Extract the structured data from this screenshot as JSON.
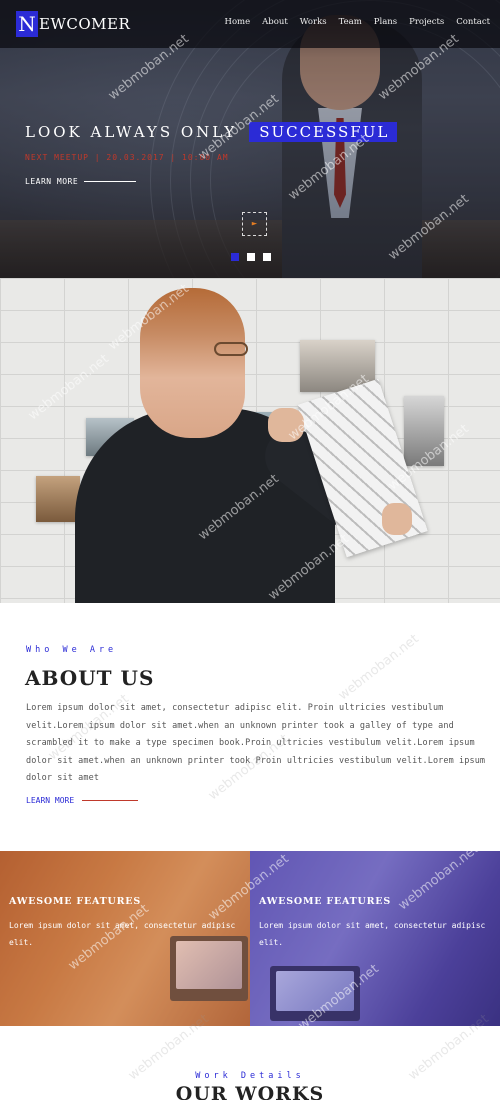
{
  "brand": {
    "initial": "N",
    "rest": "EWCOMER"
  },
  "nav": {
    "items": [
      "Home",
      "About",
      "Works",
      "Team",
      "Plans",
      "Projects",
      "Contact"
    ]
  },
  "hero": {
    "title": "LOOK ALWAYS ONLY",
    "highlight": "SUCCESSFUL",
    "meta": "NEXT MEETUP | 20.03.2017 | 10:00 AM",
    "learn_more": "LEARN MORE",
    "play_icon": "play-icon",
    "slides": 3,
    "active_slide": 1
  },
  "about": {
    "subtitle": "Who We Are",
    "title": "ABOUT US",
    "text": "Lorem ipsum dolor sit amet, consectetur adipisc elit. Proin ultricies vestibulum velit.Lorem ipsum dolor sit amet.when an unknown printer took a galley of type and scrambled it to make a type specimen book.Proin ultricies vestibulum velit.Lorem ipsum dolor sit amet.when an unknown printer took Proin ultricies vestibulum velit.Lorem ipsum dolor sit amet",
    "learn_more": "LEARN MORE"
  },
  "features": [
    {
      "title": "AWESOME FEATURES",
      "text": "Lorem ipsum dolor sit amet, consectetur adipisc elit."
    },
    {
      "title": "AWESOME FEATURES",
      "text": "Lorem ipsum dolor sit amet, consectetur adipisc elit."
    }
  ],
  "works": {
    "subtitle": "Work Details",
    "title": "OUR WORKS"
  },
  "watermark": "webmoban.net",
  "colors": {
    "accent": "#2b2bd6",
    "meta_red": "#c0392b",
    "left_tint": "#d2783c",
    "right_tint": "#5046b4"
  }
}
